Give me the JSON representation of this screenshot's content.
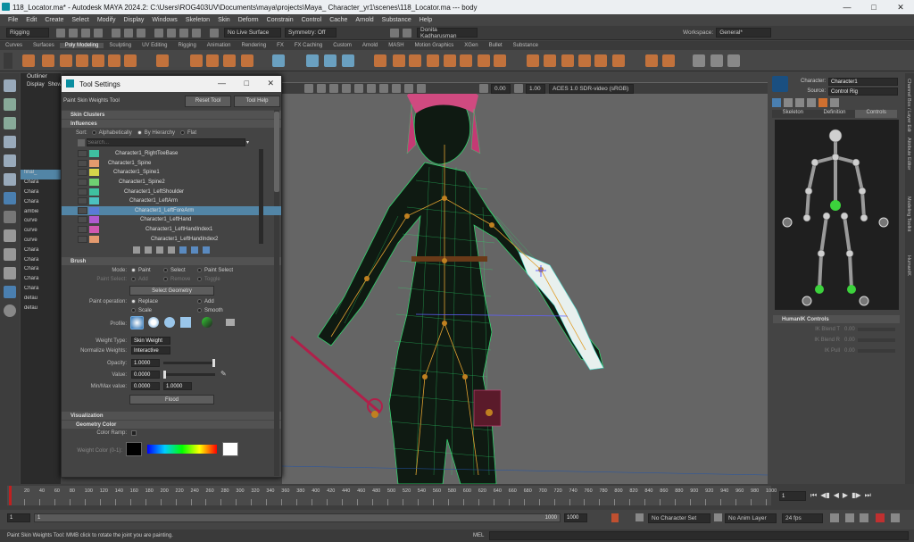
{
  "window": {
    "title": "118_Locator.ma* - Autodesk MAYA 2024.2: C:\\Users\\ROG403UV\\Documents\\maya\\projects\\Maya_ Character_yr1\\scenes\\118_Locator.ma    ---    body",
    "minimize": "—",
    "maximize": "□",
    "close": "✕"
  },
  "menu": [
    "File",
    "Edit",
    "Create",
    "Select",
    "Modify",
    "Display",
    "Windows",
    "Skeleton",
    "Skin",
    "Deform",
    "Constrain",
    "Control",
    "Cache",
    "Arnold",
    "Substance",
    "Help"
  ],
  "statusline": {
    "menuset": "Rigging",
    "live_surface": "No Live Surface",
    "symmetry": "Symmetry: Off",
    "user": "Donita Kadharusman",
    "workspace_label": "Workspace:",
    "workspace": "General*"
  },
  "shelf_tabs": [
    "Curves",
    "Surfaces",
    "Poly Modeling",
    "Sculpting",
    "UV Editing",
    "Rigging",
    "Animation",
    "Rendering",
    "FX",
    "FX Caching",
    "Custom",
    "Arnold",
    "MASH",
    "Motion Graphics",
    "XGen",
    "Bullet",
    "Substance"
  ],
  "shelf_active": "Poly Modeling",
  "outliner": {
    "title": "Outliner",
    "menu1": "Display",
    "menu2": "Show",
    "items": [
      "",
      "",
      "",
      "",
      "",
      "",
      "",
      "",
      "final_",
      "Chara",
      "Chara",
      "Chara",
      "ambie",
      "curve",
      "curve",
      "curve",
      "Chara",
      "Chara",
      "Chara",
      "Chara",
      "Chara",
      "defau",
      "defau"
    ]
  },
  "viewport": {
    "exposure": "0.00",
    "gamma": "1.00",
    "colorspace": "ACES 1.0 SDR-video (sRGB)"
  },
  "tool_settings": {
    "title": "Tool Settings",
    "tool_name": "Paint Skin Weights Tool",
    "reset": "Reset Tool",
    "help": "Tool Help",
    "sec_skin_clusters": "Skin Clusters",
    "sec_influences": "Influences",
    "sort_label": "Sort:",
    "sort_opts": [
      "Alphabetically",
      "By Hierarchy",
      "Flat"
    ],
    "search_placeholder": "Search...",
    "influences": [
      {
        "name": "Character1_RightToeBase",
        "color": "#3fc0a0",
        "indent": 60
      },
      {
        "name": "Character1_Spine",
        "color": "#e49a6e",
        "indent": 52
      },
      {
        "name": "Character1_Spine1",
        "color": "#d6d64a",
        "indent": 58
      },
      {
        "name": "Character1_Spine2",
        "color": "#6fd072",
        "indent": 64
      },
      {
        "name": "Character1_LeftShoulder",
        "color": "#3fc0a0",
        "indent": 70
      },
      {
        "name": "Character1_LeftArm",
        "color": "#4cc0c0",
        "indent": 76
      },
      {
        "name": "Character1_LeftForeArm",
        "color": "#5a7bd8",
        "indent": 82
      },
      {
        "name": "Character1_LeftHand",
        "color": "#b05ad0",
        "indent": 88
      },
      {
        "name": "Character1_LeftHandIndex1",
        "color": "#d058b0",
        "indent": 94
      },
      {
        "name": "Character1_LeftHandIndex2",
        "color": "#e49a6e",
        "indent": 100
      }
    ],
    "selected_influence": 6,
    "sec_brush": "Brush",
    "mode_label": "Mode:",
    "mode_opts": [
      "Paint",
      "Select",
      "Paint Select"
    ],
    "paint_select_label": "Paint Select:",
    "paint_select_opts": [
      "Add",
      "Remove",
      "Toggle"
    ],
    "select_geometry": "Select Geometry",
    "paint_operation_label": "Paint operation:",
    "paint_ops": [
      "Replace",
      "Add",
      "Scale",
      "Smooth"
    ],
    "profile_label": "Profile:",
    "weight_type_label": "Weight Type:",
    "weight_type": "Skin Weight",
    "normalize_label": "Normalize Weights:",
    "normalize": "Interactive",
    "opacity_label": "Opacity:",
    "opacity": "1.0000",
    "opacity_fraction": 1.0,
    "value_label": "Value:",
    "value": "0.0000",
    "value_fraction": 0.0,
    "minmax_label": "Min/Max value:",
    "min": "0.0000",
    "max": "1.0000",
    "flood": "Flood",
    "sec_visualization": "Visualization",
    "sec_geometry_color": "Geometry Color",
    "color_ramp_label": "Color Ramp:",
    "weight_color_label": "Weight Color (0-1):"
  },
  "humanik": {
    "character_label": "Character:",
    "character": "Character1",
    "source_label": "Source:",
    "source": "Control Rig",
    "tabs": [
      "Skeleton",
      "Definition",
      "Controls"
    ],
    "active_tab": "Controls",
    "controls_header": "HumanIK Controls",
    "ik_blend_t": "IK Blend T",
    "ik_blend_r": "IK Blend R",
    "ik_pull": "IK Pull",
    "zero1": "0.00",
    "zero2": "0.00",
    "zero3": "0.00"
  },
  "right_strip": [
    "Channel Box / Layer Editor",
    "Attribute Editor",
    "Modeling Toolkit",
    "HumanIK"
  ],
  "timeline": {
    "ticks": [
      "1",
      "20",
      "40",
      "60",
      "80",
      "100",
      "120",
      "140",
      "160",
      "180",
      "200",
      "220",
      "240",
      "260",
      "280",
      "300",
      "320",
      "340",
      "360",
      "380",
      "400",
      "420",
      "440",
      "460",
      "480",
      "500",
      "520",
      "540",
      "560",
      "580",
      "600",
      "620",
      "640",
      "660",
      "680",
      "700",
      "720",
      "740",
      "760",
      "780",
      "800",
      "820",
      "840",
      "860",
      "880",
      "900",
      "920",
      "940",
      "960",
      "980",
      "1000"
    ],
    "current_frame": "1"
  },
  "range": {
    "start": "1",
    "start2": "1",
    "end": "1000",
    "end2": "1000",
    "char_set": "No Character Set",
    "anim_layer": "No Anim Layer",
    "fps": "24 fps"
  },
  "help_line": "Paint Skin Weights Tool: MMB click to rotate the joint you are painting.",
  "mel": "MEL",
  "colors": {
    "accent": "#5285a6",
    "ui_bg": "#444444",
    "viewport_bg": "#656565"
  }
}
